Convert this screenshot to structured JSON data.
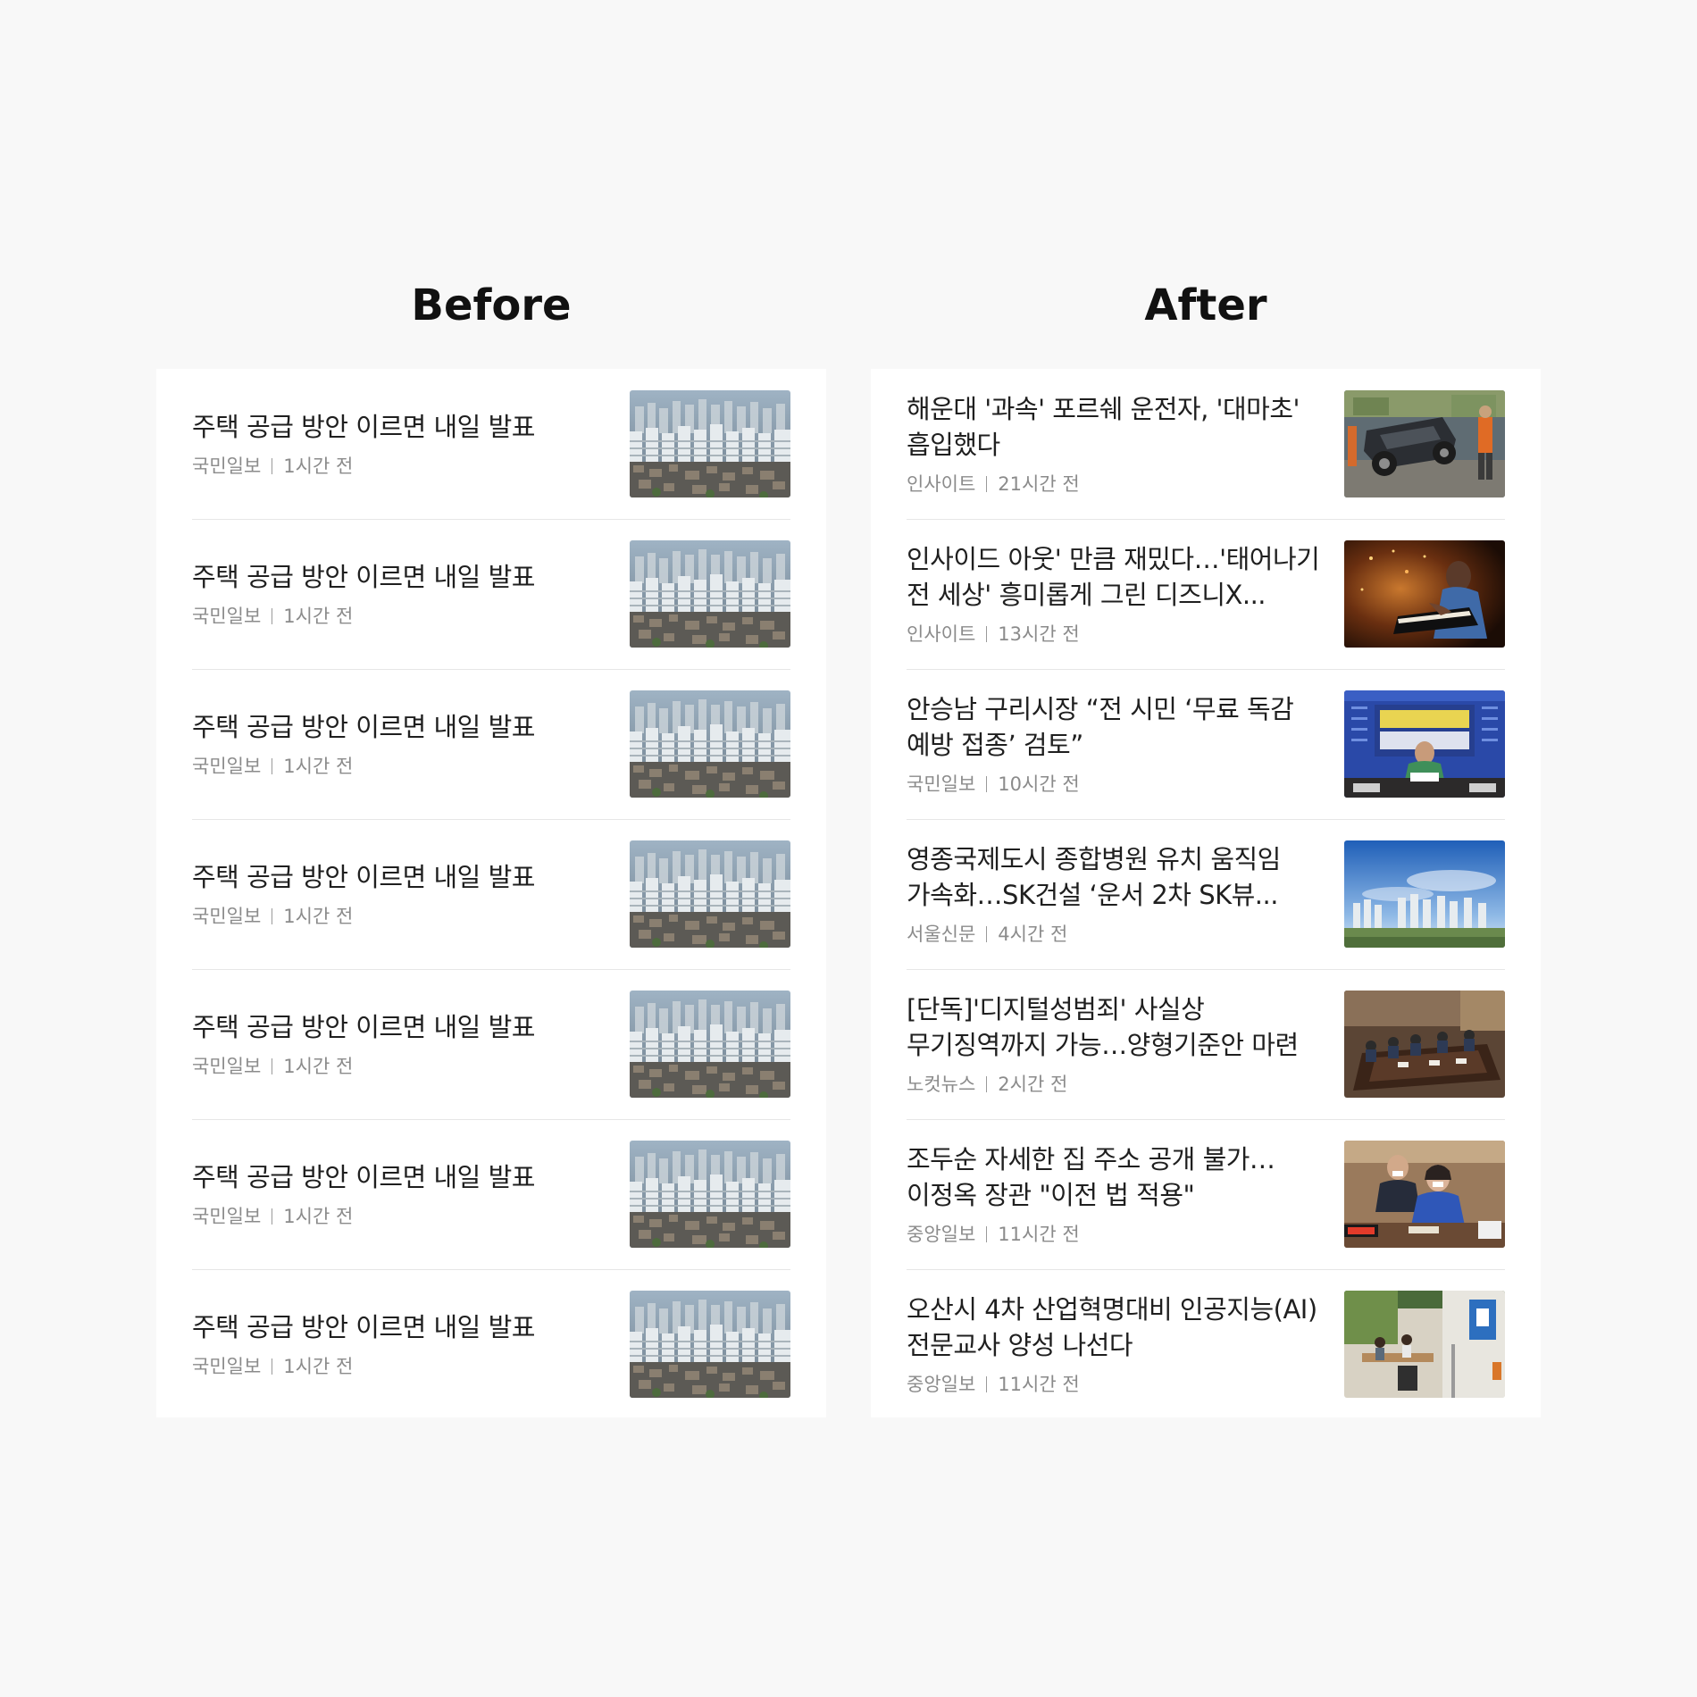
{
  "columns": {
    "before": {
      "title": "Before",
      "items": [
        {
          "headline": "주택 공급 방안 이르면 내일 발표",
          "source": "국민일보",
          "time": "1시간 전",
          "thumb": "apartment-city-thumbnail"
        },
        {
          "headline": "주택 공급 방안 이르면 내일 발표",
          "source": "국민일보",
          "time": "1시간 전",
          "thumb": "apartment-city-thumbnail"
        },
        {
          "headline": "주택 공급 방안 이르면 내일 발표",
          "source": "국민일보",
          "time": "1시간 전",
          "thumb": "apartment-city-thumbnail"
        },
        {
          "headline": "주택 공급 방안 이르면 내일 발표",
          "source": "국민일보",
          "time": "1시간 전",
          "thumb": "apartment-city-thumbnail"
        },
        {
          "headline": "주택 공급 방안 이르면 내일 발표",
          "source": "국민일보",
          "time": "1시간 전",
          "thumb": "apartment-city-thumbnail"
        },
        {
          "headline": "주택 공급 방안 이르면 내일 발표",
          "source": "국민일보",
          "time": "1시간 전",
          "thumb": "apartment-city-thumbnail"
        },
        {
          "headline": "주택 공급 방안 이르면 내일 발표",
          "source": "국민일보",
          "time": "1시간 전",
          "thumb": "apartment-city-thumbnail"
        }
      ]
    },
    "after": {
      "title": "After",
      "items": [
        {
          "headline": "해운대 '과속' 포르쉐 운전자, '대마초' 흡입했다",
          "source": "인사이트",
          "time": "21시간 전",
          "thumb": "car-crash-thumbnail"
        },
        {
          "headline": "인사이드 아웃' 만큼 재밌다…'태어나기 전 세상' 흥미롭게 그린 디즈니X...",
          "source": "인사이트",
          "time": "13시간 전",
          "thumb": "piano-animation-thumbnail"
        },
        {
          "headline": "안승남 구리시장 “전 시민 ‘무료 독감 예방 접종’ 검토”",
          "source": "국민일보",
          "time": "10시간 전",
          "thumb": "press-conference-thumbnail"
        },
        {
          "headline": "영종국제도시 종합병원 유치 움직임 가속화…SK건설 ‘운서 2차 SK뷰...",
          "source": "서울신문",
          "time": "4시간 전",
          "thumb": "apartment-skyline-thumbnail"
        },
        {
          "headline": "[단독]'디지털성범죄' 사실상 무기징역까지 가능…양형기준안 마련",
          "source": "노컷뉴스",
          "time": "2시간 전",
          "thumb": "meeting-room-thumbnail"
        },
        {
          "headline": "조두순 자세한 집 주소 공개 불가…이정옥 장관 \"이전 법 적용\"",
          "source": "중앙일보",
          "time": "11시간 전",
          "thumb": "minister-hearing-thumbnail"
        },
        {
          "headline": "오산시 4차 산업혁명대비 인공지능(AI) 전문교사 양성 나선다",
          "source": "중앙일보",
          "time": "11시간 전",
          "thumb": "classroom-thumbnail"
        }
      ]
    }
  }
}
